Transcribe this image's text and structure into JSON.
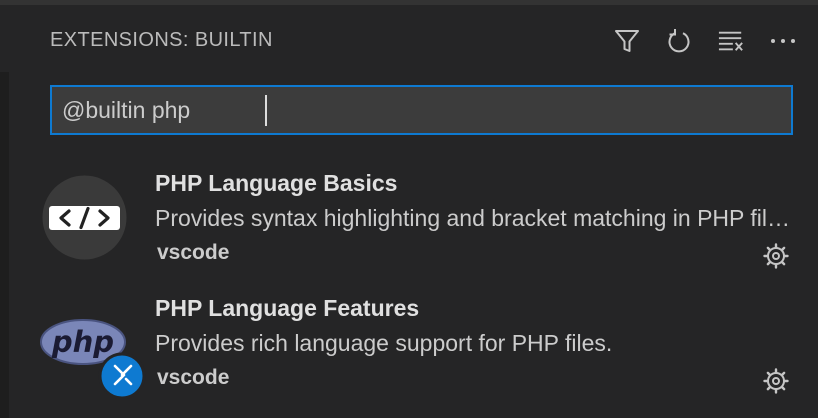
{
  "header": {
    "title": "EXTENSIONS: BUILTIN",
    "actions": [
      {
        "name": "filter-icon"
      },
      {
        "name": "refresh-icon"
      },
      {
        "name": "clear-extensions-input-icon"
      },
      {
        "name": "more-actions-icon"
      }
    ]
  },
  "search": {
    "value": "@builtin php"
  },
  "extensions": [
    {
      "name": "PHP Language Basics",
      "description": "Provides syntax highlighting and bracket matching in PHP files.",
      "publisher": "vscode",
      "icon": "code-brackets-icon"
    },
    {
      "name": "PHP Language Features",
      "description": "Provides rich language support for PHP files.",
      "publisher": "vscode",
      "icon": "php-logo-icon",
      "badge": "remote-icon"
    }
  ],
  "colors": {
    "background": "#252526",
    "focus_border": "#0e7ad1",
    "input_background": "#3c3c3c",
    "remote_badge": "#0e7ad1",
    "php_logo": "#7a86b8"
  }
}
